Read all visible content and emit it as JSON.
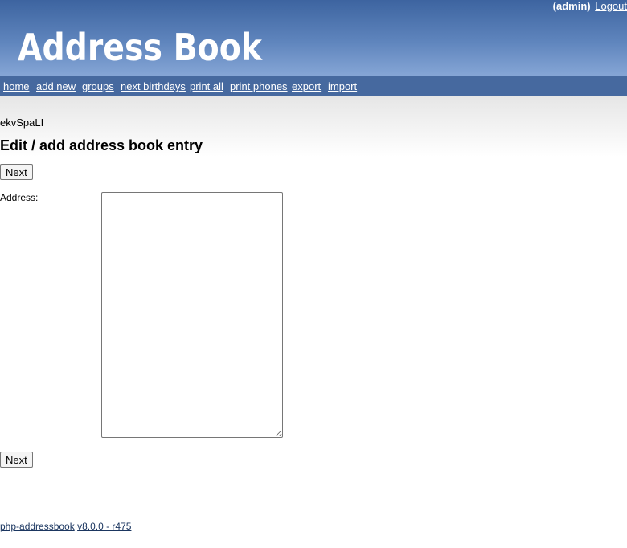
{
  "header": {
    "user": "(admin)",
    "logout_label": "Logout",
    "logo_text": "Address Book"
  },
  "nav": {
    "items": [
      {
        "label": "home"
      },
      {
        "label": "add new"
      },
      {
        "label": "groups"
      },
      {
        "label": "next birthdays"
      },
      {
        "label": "print all"
      },
      {
        "label": "print phones"
      },
      {
        "label": "export"
      },
      {
        "label": "import"
      }
    ]
  },
  "content": {
    "group_name": "ekvSpaLI",
    "title": "Edit / add address book entry",
    "next_button_label": "Next",
    "address_label": "Address:",
    "address_value": ""
  },
  "footer": {
    "app_link": "php-addressbook",
    "version_link": "v8.0.0 - r475"
  },
  "colors": {
    "header_top": "#3d64a0",
    "header_bottom": "#86a6d6",
    "nav_bg": "#46699f",
    "footer_link": "#1b3660"
  }
}
